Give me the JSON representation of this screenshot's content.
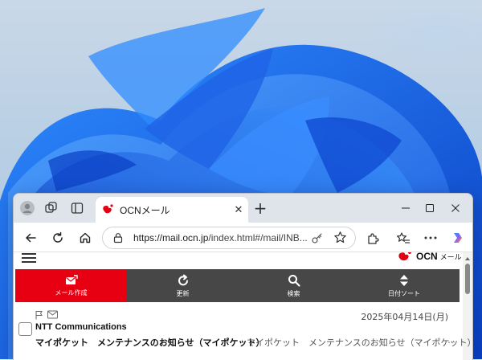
{
  "browser": {
    "tab_title": "OCNメール",
    "url_host": "https://mail.ocn.jp",
    "url_path": "/index.html#/mail/INB..."
  },
  "app": {
    "logo_text": "OCN",
    "logo_sub": "メール",
    "menu": {
      "compose": "メール作成",
      "refresh": "更新",
      "search": "検索",
      "sort_date": "日付ソート"
    }
  },
  "mail_list": [
    {
      "date": "2025年04月14日(月)",
      "sender": "NTT Communications",
      "subject": "マイポケット　メンテナンスのお知らせ（マイポケット）",
      "preview": "マイポケット　メンテナンスのお知らせ（マイポケット）",
      "more": "…"
    }
  ],
  "colors": {
    "accent_red": "#e60012",
    "menu_gray": "#474747"
  }
}
